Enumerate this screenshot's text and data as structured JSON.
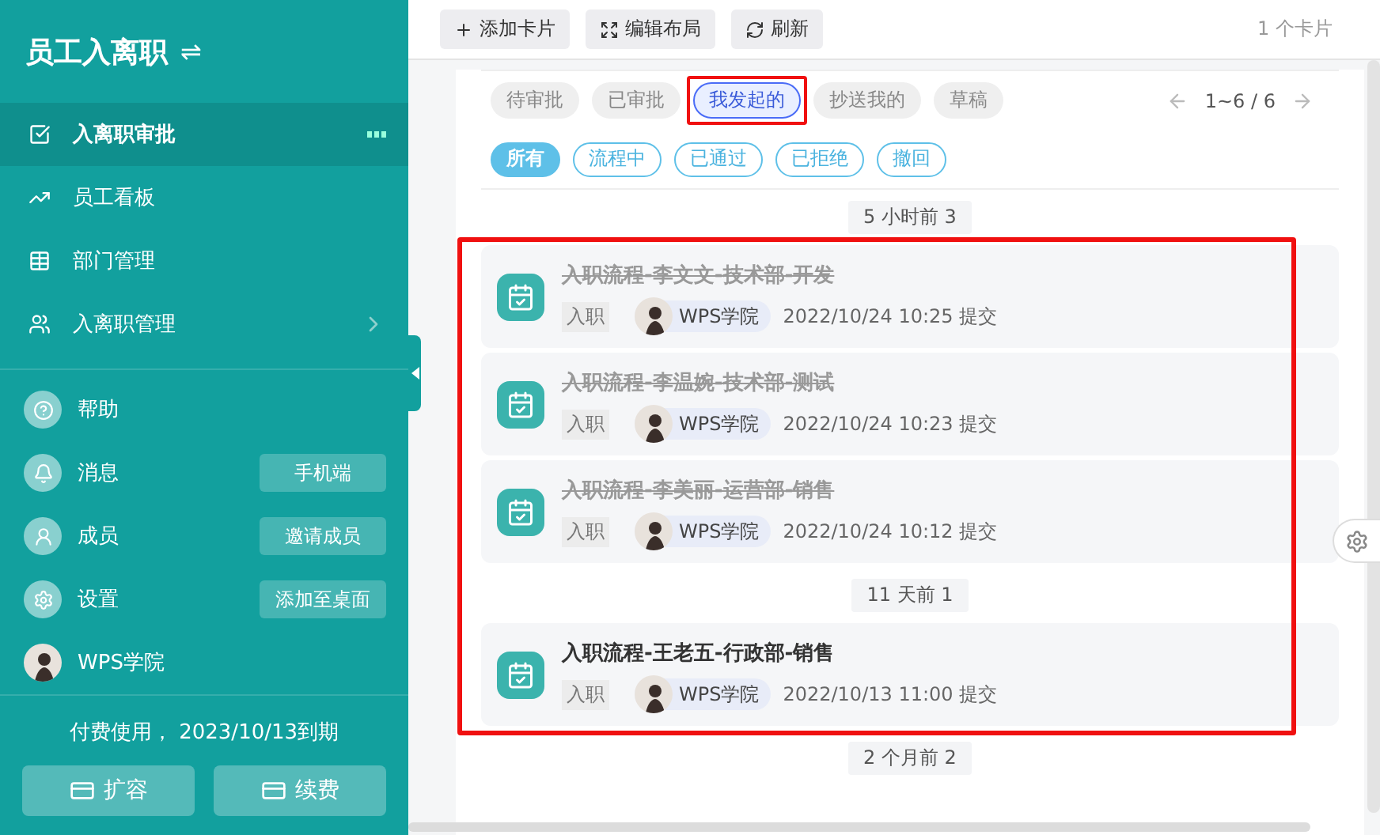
{
  "sidebar": {
    "title": "员工入离职",
    "switch_icon": "⇌",
    "menu": [
      {
        "label": "入离职审批",
        "selected": true,
        "more": true,
        "submenu": false
      },
      {
        "label": "员工看板",
        "selected": false,
        "more": false,
        "submenu": false
      },
      {
        "label": "部门管理",
        "selected": false,
        "more": false,
        "submenu": false
      },
      {
        "label": "入离职管理",
        "selected": false,
        "more": false,
        "submenu": true
      }
    ],
    "links": [
      {
        "label": "帮助"
      },
      {
        "label": "消息",
        "action": "手机端"
      },
      {
        "label": "成员",
        "action": "邀请成员"
      },
      {
        "label": "设置",
        "action": "添加至桌面"
      },
      {
        "label": "WPS学院"
      }
    ],
    "plan": "付费使用， 2023/10/13到期",
    "buttons": [
      "扩容",
      "续费"
    ]
  },
  "toolbar": {
    "buttons": [
      "添加卡片",
      "编辑布局",
      "刷新"
    ],
    "card_count": "1 个卡片"
  },
  "tabs": [
    {
      "label": "待审批",
      "selected": false,
      "highlighted": false
    },
    {
      "label": "已审批",
      "selected": false,
      "highlighted": false
    },
    {
      "label": "我发起的",
      "selected": true,
      "highlighted": true
    },
    {
      "label": "抄送我的",
      "selected": false,
      "highlighted": false
    },
    {
      "label": "草稿",
      "selected": false,
      "highlighted": false
    }
  ],
  "pager": "1~6 / 6",
  "filters": [
    {
      "label": "所有",
      "selected": true
    },
    {
      "label": "流程中",
      "selected": false
    },
    {
      "label": "已通过",
      "selected": false
    },
    {
      "label": "已拒绝",
      "selected": false
    },
    {
      "label": "撤回",
      "selected": false
    }
  ],
  "groups": [
    {
      "label": "5 小时前 3",
      "highlighted": true,
      "items": [
        {
          "title": "入职流程-李文文-技术部-开发",
          "struck": true,
          "tag": "入职",
          "user": "WPS学院",
          "time": "2022/10/24 10:25 提交"
        },
        {
          "title": "入职流程-李温婉-技术部-测试",
          "struck": true,
          "tag": "入职",
          "user": "WPS学院",
          "time": "2022/10/24 10:23 提交"
        },
        {
          "title": "入职流程-李美丽-运营部-销售",
          "struck": true,
          "tag": "入职",
          "user": "WPS学院",
          "time": "2022/10/24 10:12 提交"
        }
      ]
    },
    {
      "label": "11 天前 1",
      "highlighted": true,
      "items": [
        {
          "title": "入职流程-王老五-行政部-销售",
          "struck": false,
          "tag": "入职",
          "user": "WPS学院",
          "time": "2022/10/13 11:00 提交"
        }
      ]
    },
    {
      "label": "2 个月前 2",
      "highlighted": false
    }
  ]
}
